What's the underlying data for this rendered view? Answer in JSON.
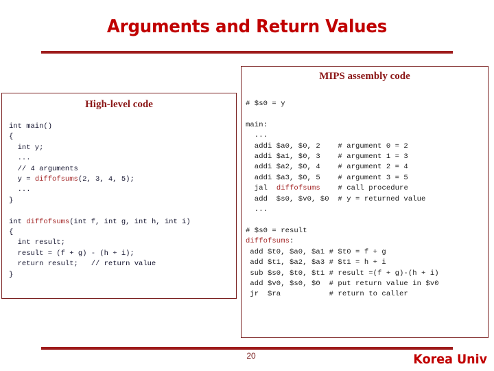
{
  "slide": {
    "title": "Arguments and Return Values",
    "accent_color": "#c00000",
    "rule_color": "#9e1b1b",
    "box_border_color": "#7a2020"
  },
  "high_level_panel": {
    "heading": "High-level code",
    "highlight_identifier": "diffofsums",
    "code_part1": "int main()\n{\n  int y;\n  ...\n  // 4 arguments\n  y = ",
    "code_part2": "(2, 3, 4, 5);\n  ...\n}\n\nint ",
    "code_part3": "(int f, int g, int h, int i)\n{\n  int result;\n  result = (f + g) - (h + i);\n  return result;   // return value\n}",
    "full_code": "int main()\n{\n  int y;\n  ...\n  // 4 arguments\n  y = diffofsums(2, 3, 4, 5);\n  ...\n}\n\nint diffofsums(int f, int g, int h, int i)\n{\n  int result;\n  result = (f + g) - (h + i);\n  return result;   // return value\n}"
  },
  "mips_panel": {
    "heading": "MIPS assembly code",
    "highlight_identifier": "diffofsums",
    "code_part1": "# $s0 = y\n\nmain:\n  ...\n  addi $a0, $0, 2    # argument 0 = 2\n  addi $a1, $0, 3    # argument 1 = 3\n  addi $a2, $0, 4    # argument 2 = 4\n  addi $a3, $0, 5    # argument 3 = 5\n  jal  ",
    "code_part2": "    # call procedure\n  add  $s0, $v0, $0  # y = returned value\n  ...\n\n# $s0 = result\n",
    "code_part3": ":\n add $t0, $a0, $a1 # $t0 = f + g\n add $t1, $a2, $a3 # $t1 = h + i\n sub $s0, $t0, $t1 # result =(f + g)-(h + i)\n add $v0, $s0, $0  # put return value in $v0\n jr  $ra           # return to caller",
    "full_code": "# $s0 = y\n\nmain:\n  ...\n  addi $a0, $0, 2    # argument 0 = 2\n  addi $a1, $0, 3    # argument 1 = 3\n  addi $a2, $0, 4    # argument 2 = 4\n  addi $a3, $0, 5    # argument 3 = 5\n  jal  diffofsums    # call procedure\n  add  $s0, $v0, $0  # y = returned value\n  ...\n\n# $s0 = result\ndiffofsums:\n add $t0, $a0, $a1 # $t0 = f + g\n add $t1, $a2, $a3 # $t1 = h + i\n sub $s0, $t0, $t1 # result =(f + g)-(h + i)\n add $v0, $s0, $0  # put return value in $v0\n jr  $ra           # return to caller"
  },
  "footer": {
    "page_number": "20",
    "brand": "Korea Univ"
  }
}
